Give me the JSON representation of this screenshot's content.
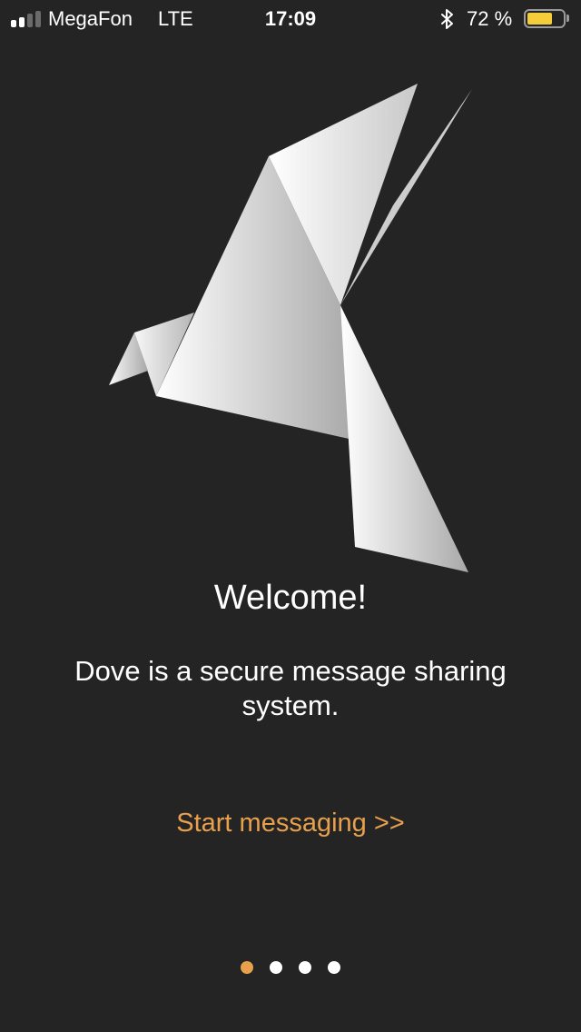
{
  "status_bar": {
    "carrier": "MegaFon",
    "network": "LTE",
    "time": "17:09",
    "battery_percent_label": "72 %",
    "battery_level": 0.72,
    "signal_bars_filled": 2,
    "signal_bars_total": 4,
    "bluetooth_icon": "bluetooth-icon"
  },
  "illustration": {
    "icon": "origami-dove-icon"
  },
  "welcome": {
    "title": "Welcome!",
    "description": "Dove is a secure message sharing system.",
    "start_label": "Start messaging >>"
  },
  "pager": {
    "active_index": 0,
    "count": 4
  },
  "colors": {
    "background": "#242424",
    "accent": "#e8a04c",
    "battery_fill": "#f5cc3a",
    "text": "#ffffff",
    "dot_inactive": "#ffffff",
    "signal_active": "#ffffff",
    "signal_inactive": "#6a6a6a"
  }
}
